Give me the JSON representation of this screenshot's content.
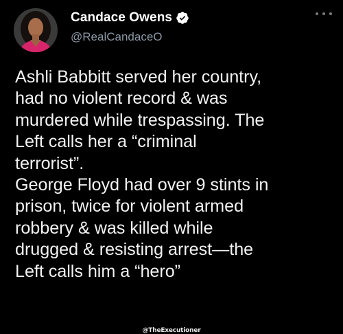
{
  "header": {
    "display_name": "Candace Owens",
    "handle": "@RealCandaceO",
    "verified": true,
    "avatar_icon": "profile-photo",
    "more_icon": "more-options-icon"
  },
  "tweet": {
    "lines": [
      "Ashli Babbitt served her country,",
      "had no violent record & was",
      "murdered while trespassing. The",
      "Left calls her a “criminal",
      "terrorist”.",
      "George Floyd had over 9 stints in",
      "prison, twice for violent armed",
      "robbery & was killed while",
      "drugged & resisting arrest—the",
      "Left calls him a “hero”"
    ]
  },
  "watermark": "@TheExecutioner",
  "colors": {
    "background": "#000000",
    "text": "#f2f2f2",
    "handle": "#8b98a5",
    "verified": "#1d9bf0"
  }
}
